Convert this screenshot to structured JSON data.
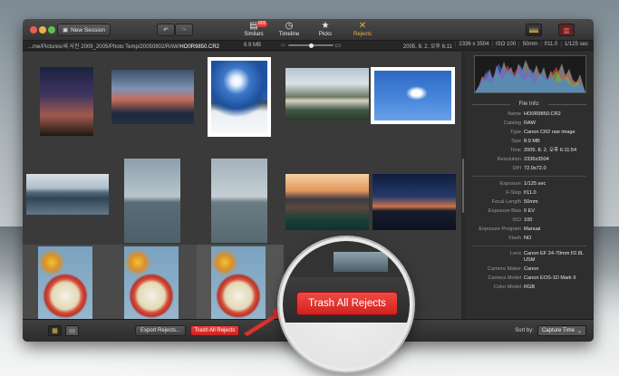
{
  "toolbar": {
    "new_session_label": "New Session",
    "tools": [
      {
        "label": "Similars",
        "icon": "stack-icon",
        "badge": "805"
      },
      {
        "label": "Timeline",
        "icon": "clock-icon"
      },
      {
        "label": "Picks",
        "icon": "star-icon"
      },
      {
        "label": "Rejects",
        "icon": "x-icon"
      }
    ]
  },
  "infobar": {
    "path_prefix": "...me/Pictures/새 사진 2009_2005/Photo Temp/20050802/RAW/",
    "path_file": "HO0R9850.CR2",
    "size": "8.9 MB",
    "slider_value": 0.5,
    "date": "2005. 8. 2. 오후 6:11",
    "dimensions": "2336 x 3504",
    "iso": "ISO 100",
    "focal": "50mm",
    "fstop": "f/11.0",
    "shutter": "1/125 sec"
  },
  "file_info": {
    "title": "File Info:",
    "rows_a": [
      {
        "k": "Name",
        "v": "HO0R9850.CR2"
      },
      {
        "k": "Catalog",
        "v": "RAW"
      },
      {
        "k": "Type",
        "v": "Canon CR2 raw image"
      },
      {
        "k": "Size",
        "v": "8.9 MB"
      },
      {
        "k": "Time",
        "v": "2005. 8. 2. 오후 6:11:54"
      },
      {
        "k": "Resolution",
        "v": "2336x3504"
      },
      {
        "k": "DPI",
        "v": "72.0x72.0"
      }
    ],
    "rows_b": [
      {
        "k": "Exposure",
        "v": "1/125 sec"
      },
      {
        "k": "F-Stop",
        "v": "f/11.0"
      },
      {
        "k": "Focal Length",
        "v": "50mm"
      },
      {
        "k": "Exposure Bias",
        "v": "0 EV"
      },
      {
        "k": "ISO",
        "v": "100"
      },
      {
        "k": "Exposure Program",
        "v": "Manual"
      },
      {
        "k": "Flash",
        "v": "NO"
      }
    ],
    "rows_c": [
      {
        "k": "Lens",
        "v": "Canon EF 24-70mm f/2.8L USM"
      },
      {
        "k": "Camera Maker",
        "v": "Canon"
      },
      {
        "k": "Camera Model",
        "v": "Canon EOS-1D Mark II"
      },
      {
        "k": "Color Model",
        "v": "RGB"
      }
    ]
  },
  "bottombar": {
    "export_label": "Export Rejects...",
    "trash_label": "Trash All Rejects",
    "sort_label": "Sort by:",
    "sort_value": "Capture Time"
  },
  "callout": {
    "trash_label": "Trash All Rejects"
  },
  "colors": {
    "accent_reject": "#f5a84a",
    "trash_red": "#e23a36",
    "badge_red": "#e23a36"
  }
}
